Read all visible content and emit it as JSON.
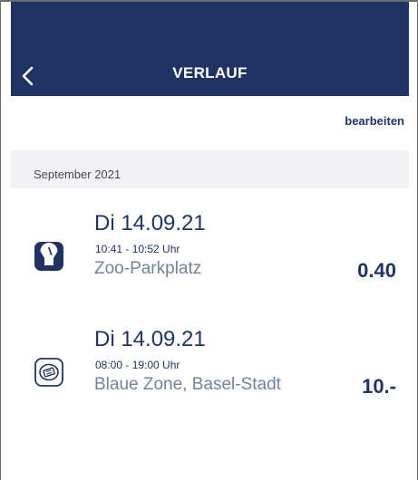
{
  "header": {
    "title": "VERLAUF",
    "back_icon": "chevron-left-icon",
    "background": "#1f3464"
  },
  "toolbar": {
    "edit_label": "bearbeiten"
  },
  "section": {
    "month": "September 2021"
  },
  "items": [
    {
      "date": "Di 14.09.21",
      "time": "10:41 - 10:52 Uhr",
      "place": "Zoo-Parkplatz",
      "amount": "0.40",
      "icon": "parking-meter-icon"
    },
    {
      "date": "Di 14.09.21",
      "time": "08:00 - 19:00 Uhr",
      "place": "Blaue Zone, Basel-Stadt",
      "amount": "10.-",
      "icon": "parking-disc-icon"
    }
  ],
  "colors": {
    "primary": "#1f3464",
    "secondary_text": "#6f84a1",
    "section_bg": "#f2f2f4"
  }
}
